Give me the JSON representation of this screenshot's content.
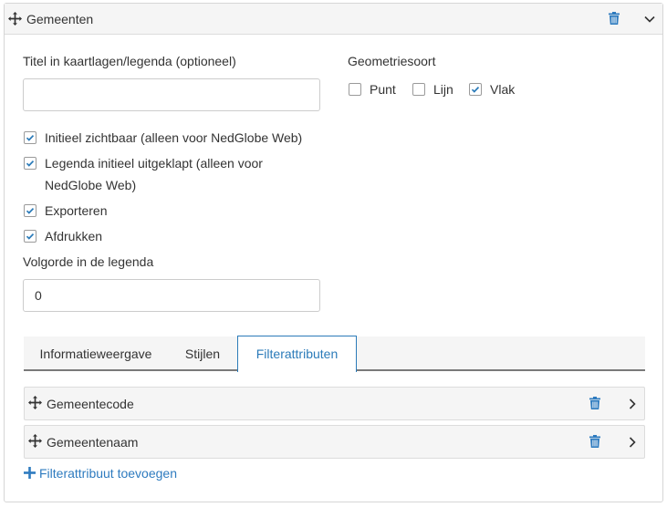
{
  "panel": {
    "title": "Gemeenten",
    "colors": {
      "accent": "#2b7bb9",
      "icon_blue": "#2e7bbf",
      "header_bg": "#f5f5f5"
    }
  },
  "form": {
    "title_label": "Titel in kaartlagen/legenda (optioneel)",
    "title_value": "",
    "geometry_label": "Geometriesoort",
    "geometry_options": [
      {
        "label": "Punt",
        "checked": false
      },
      {
        "label": "Lijn",
        "checked": false
      },
      {
        "label": "Vlak",
        "checked": true
      }
    ],
    "checkboxes": [
      {
        "label": "Initieel zichtbaar (alleen voor NedGlobe Web)",
        "checked": true
      },
      {
        "label_line1": "Legenda initieel uitgeklapt (alleen voor",
        "label_line2": "NedGlobe Web)",
        "checked": true
      },
      {
        "label": "Exporteren",
        "checked": true
      },
      {
        "label": "Afdrukken",
        "checked": true
      }
    ],
    "order_label": "Volgorde in de legenda",
    "order_value": "0"
  },
  "tabs": [
    {
      "label": "Informatieweergave",
      "active": false
    },
    {
      "label": "Stijlen",
      "active": false
    },
    {
      "label": "Filterattributen",
      "active": true
    }
  ],
  "filter_attributes": [
    {
      "label": "Gemeentecode"
    },
    {
      "label": "Gemeentenaam"
    }
  ],
  "add_link": {
    "label": "Filterattribuut toevoegen"
  }
}
